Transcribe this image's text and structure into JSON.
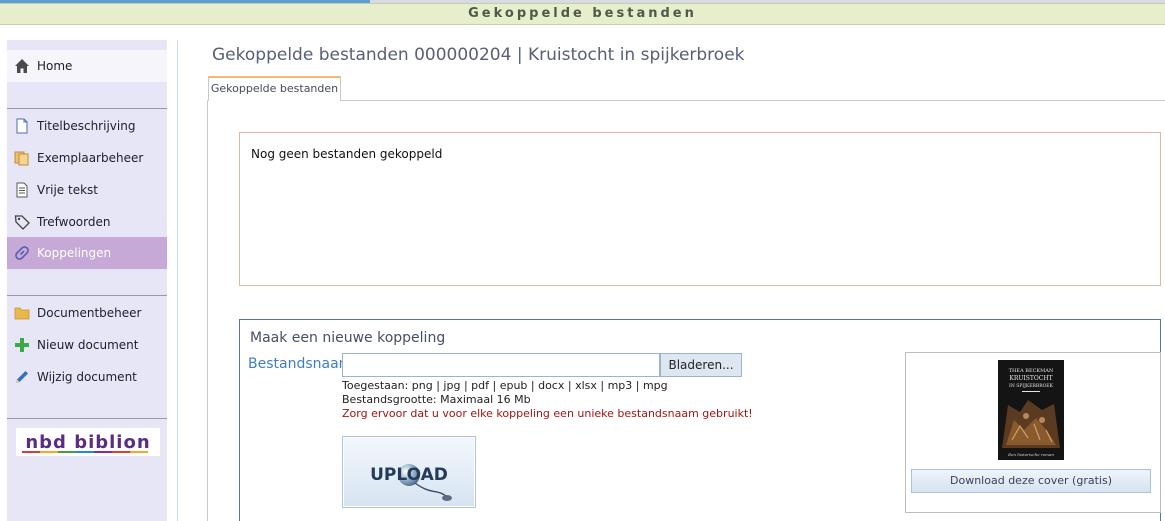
{
  "header": {
    "title": "Gekoppelde bestanden"
  },
  "sidebar": {
    "home": {
      "label": "Home",
      "icon": "home-icon"
    },
    "items": [
      {
        "label": "Titelbeschrijving",
        "icon": "document-icon"
      },
      {
        "label": "Exemplaarbeheer",
        "icon": "copies-icon"
      },
      {
        "label": "Vrije tekst",
        "icon": "text-document-icon"
      },
      {
        "label": "Trefwoorden",
        "icon": "tag-icon"
      },
      {
        "label": "Koppelingen",
        "icon": "link-icon",
        "active": true
      }
    ],
    "items2": [
      {
        "label": "Documentbeheer",
        "icon": "folder-icon"
      },
      {
        "label": "Nieuw document",
        "icon": "plus-icon"
      },
      {
        "label": "Wijzig document",
        "icon": "pencil-icon"
      }
    ],
    "logo": "nbd biblion"
  },
  "main": {
    "title": "Gekoppelde bestanden 000000204 | Kruistocht in spijkerbroek",
    "tab": "Gekoppelde bestanden",
    "empty_message": "Nog geen bestanden gekoppeld",
    "upload": {
      "title": "Maak een nieuwe koppeling",
      "label": "Bestandsnaam",
      "file_value": "",
      "browse_label": "Bladeren...",
      "allowed": "Toegestaan: png | jpg | pdf | epub | docx | xlsx | mp3 | mpg",
      "max_size": "Bestandsgrootte: Maximaal 16 Mb",
      "warning": "Zorg ervoor dat u voor elke koppeling een unieke bestandsnaam gebruikt!",
      "upload_image_label": "UPLOAD"
    },
    "cover": {
      "author": "THEA BECKMAN",
      "title_line1": "KRUISTOCHT",
      "title_line2": "IN SPIJKERBROEK",
      "subtitle": "Een historische roman",
      "download_label": "Download deze cover (gratis)"
    }
  },
  "colors": {
    "header_bg": "#e6eecb",
    "sidebar_bg": "#e6e6f6",
    "active_item": "#c6a9d6",
    "link_blue": "#3f7ec4",
    "warning_red": "#a31414"
  }
}
